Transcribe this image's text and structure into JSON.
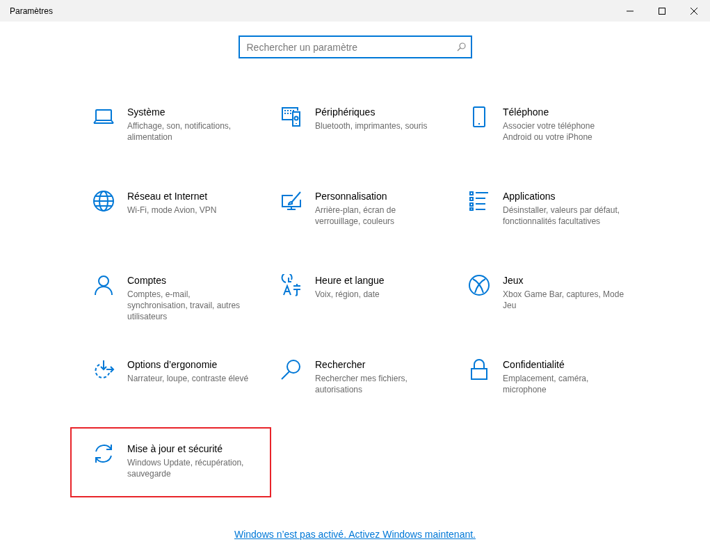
{
  "window": {
    "title": "Paramètres"
  },
  "search": {
    "placeholder": "Rechercher un paramètre"
  },
  "tiles": [
    {
      "kind": "laptop",
      "title": "Système",
      "subtitle": "Affichage, son, notifications, alimentation",
      "highlighted": false
    },
    {
      "kind": "devices",
      "title": "Périphériques",
      "subtitle": "Bluetooth, imprimantes, souris",
      "highlighted": false
    },
    {
      "kind": "phone",
      "title": "Téléphone",
      "subtitle": "Associer votre téléphone Android ou votre iPhone",
      "highlighted": false
    },
    {
      "kind": "globe",
      "title": "Réseau et Internet",
      "subtitle": "Wi-Fi, mode Avion, VPN",
      "highlighted": false
    },
    {
      "kind": "brush",
      "title": "Personnalisation",
      "subtitle": "Arrière-plan, écran de verrouillage, couleurs",
      "highlighted": false
    },
    {
      "kind": "apps",
      "title": "Applications",
      "subtitle": "Désinstaller, valeurs par défaut, fonctionnalités facultatives",
      "highlighted": false
    },
    {
      "kind": "person",
      "title": "Comptes",
      "subtitle": "Comptes, e-mail, synchronisation, travail, autres utilisateurs",
      "highlighted": false
    },
    {
      "kind": "time",
      "title": "Heure et langue",
      "subtitle": "Voix, région, date",
      "highlighted": false
    },
    {
      "kind": "xbox",
      "title": "Jeux",
      "subtitle": "Xbox Game Bar, captures, Mode Jeu",
      "highlighted": false
    },
    {
      "kind": "ease",
      "title": "Options d’ergonomie",
      "subtitle": "Narrateur, loupe, contraste élevé",
      "highlighted": false
    },
    {
      "kind": "search",
      "title": "Rechercher",
      "subtitle": "Rechercher mes fichiers, autorisations",
      "highlighted": false
    },
    {
      "kind": "lock",
      "title": "Confidentialité",
      "subtitle": "Emplacement, caméra, microphone",
      "highlighted": false
    },
    {
      "kind": "sync",
      "title": "Mise à jour et sécurité",
      "subtitle": "Windows Update, récupération, sauvegarde",
      "highlighted": true
    }
  ],
  "activation_link": "Windows n’est pas activé. Activez Windows maintenant."
}
